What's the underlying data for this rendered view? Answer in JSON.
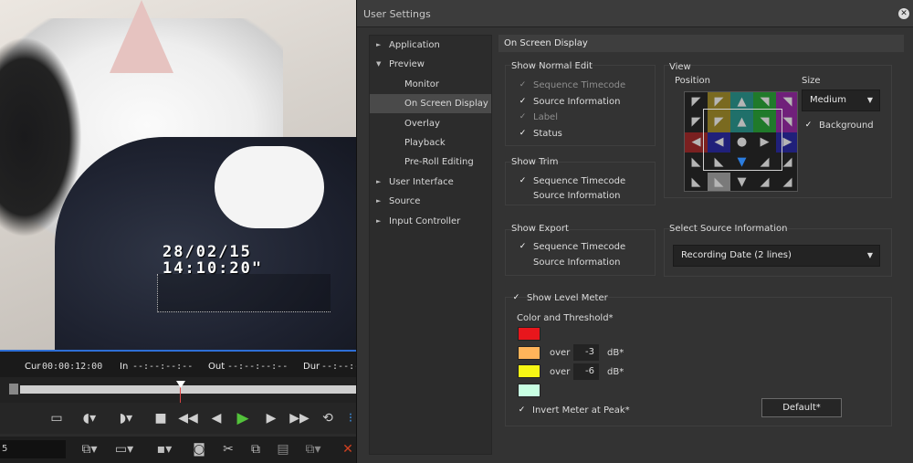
{
  "preview": {
    "osd_date": "28/02/15",
    "osd_time": "14:10:20\""
  },
  "timecode_bar": {
    "cur_label": "Cur",
    "cur_value": "00:00:12:00",
    "in_label": "In",
    "in_value": "--:--:--:--",
    "out_label": "Out",
    "out_value": "--:--:--:--",
    "dur_label": "Dur",
    "dur_value": "--:--:--:--"
  },
  "bottom_toolbar": {
    "field_value": "5"
  },
  "dialog": {
    "title": "User Settings",
    "tree": [
      {
        "label": "Application",
        "arrow": "►",
        "level": 0,
        "selected": false
      },
      {
        "label": "Preview",
        "arrow": "▼",
        "level": 0,
        "selected": false
      },
      {
        "label": "Monitor",
        "arrow": "",
        "level": 1,
        "selected": false
      },
      {
        "label": "On Screen Display",
        "arrow": "",
        "level": 1,
        "selected": true
      },
      {
        "label": "Overlay",
        "arrow": "",
        "level": 1,
        "selected": false
      },
      {
        "label": "Playback",
        "arrow": "",
        "level": 1,
        "selected": false
      },
      {
        "label": "Pre-Roll Editing",
        "arrow": "",
        "level": 1,
        "selected": false
      },
      {
        "label": "User Interface",
        "arrow": "►",
        "level": 0,
        "selected": false
      },
      {
        "label": "Source",
        "arrow": "►",
        "level": 0,
        "selected": false
      },
      {
        "label": "Input Controller",
        "arrow": "►",
        "level": 0,
        "selected": false
      }
    ],
    "content_title": "On Screen Display",
    "show_normal_edit": {
      "title": "Show Normal Edit",
      "items": [
        {
          "label": "Sequence Timecode",
          "checked": true,
          "disabled": true
        },
        {
          "label": "Source Information",
          "checked": true,
          "disabled": false
        },
        {
          "label": "Label",
          "checked": true,
          "disabled": true
        },
        {
          "label": "Status",
          "checked": true,
          "disabled": false
        }
      ]
    },
    "show_trim": {
      "title": "Show Trim",
      "items": [
        {
          "label": "Sequence Timecode",
          "checked": true,
          "disabled": false
        },
        {
          "label": "Source Information",
          "checked": false,
          "disabled": false
        }
      ]
    },
    "show_export": {
      "title": "Show Export",
      "items": [
        {
          "label": "Sequence Timecode",
          "checked": true,
          "disabled": false
        },
        {
          "label": "Source Information",
          "checked": false,
          "disabled": false
        }
      ]
    },
    "view": {
      "title": "View",
      "position_label": "Position",
      "size_label": "Size",
      "size_value": "Medium",
      "background_label": "Background",
      "background_checked": true
    },
    "select_source_info": {
      "title": "Select Source Information",
      "value": "Recording Date (2 lines)"
    },
    "level_meter": {
      "show_label": "Show Level Meter",
      "show_checked": true,
      "color_threshold_label": "Color and Threshold*",
      "colors": [
        "#e8161c",
        "#ffb45a",
        "#f6f614",
        "#c8ffe2"
      ],
      "over_label": "over",
      "threshold1": "-3",
      "threshold2": "-6",
      "unit": "dB*",
      "invert_label": "Invert Meter at Peak*",
      "invert_checked": true,
      "default_button": "Default*"
    }
  }
}
